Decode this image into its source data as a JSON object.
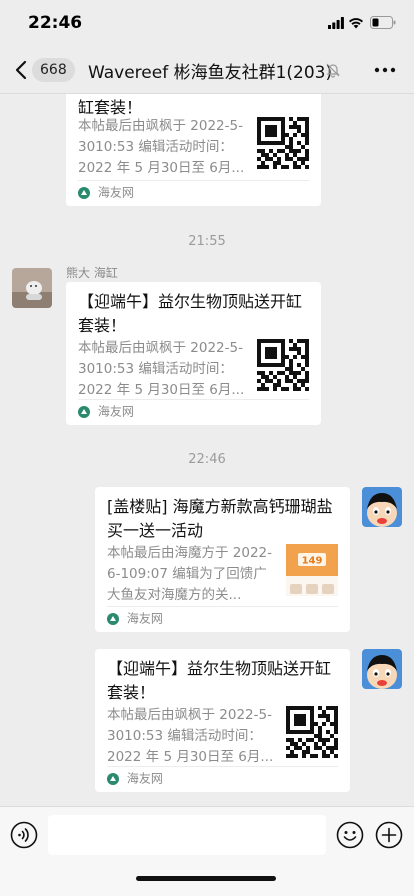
{
  "status_bar": {
    "time": "22:46"
  },
  "nav": {
    "unread_count": "668",
    "title": "Wavereef 彬海鱼友社群1(203)"
  },
  "messages": [
    {
      "title": "缸套装！",
      "desc": "本帖最后由飒枫于 2022-5-3010:53 编辑活动时间：2022 年 5 月30日至 6月...",
      "source": "海友网"
    },
    {
      "time": "21:55",
      "sender": "熊大 海缸",
      "title": "【迎端午】益尔生物顶贴送开缸套装！",
      "desc": "本帖最后由飒枫于 2022-5-3010:53 编辑活动时间：2022 年 5 月30日至 6月...",
      "source": "海友网"
    },
    {
      "time": "22:46",
      "title": "[盖楼贴] 海魔方新款高钙珊瑚盐买一送一活动",
      "desc": "本帖最后由海魔方于 2022-6-109:07 编辑为了回馈广大鱼友对海魔方的关...",
      "source": "海友网"
    },
    {
      "title": "【迎端午】益尔生物顶贴送开缸套装！",
      "desc": "本帖最后由飒枫于 2022-5-3010:53 编辑活动时间：2022 年 5 月30日至 6月...",
      "source": "海友网"
    }
  ],
  "thumb_badge_text": "149",
  "colors": {
    "background": "#ededed",
    "card": "#ffffff",
    "muted_text": "#8c8c8c",
    "source_icon": "#2b8a6e"
  },
  "icons": {
    "back": "chevron-left-icon",
    "mute": "bell-slash-icon",
    "more": "more-dots-icon",
    "voice": "voice-icon",
    "emoji": "emoji-icon",
    "plus": "plus-icon",
    "source": "haiyou-logo-icon"
  }
}
